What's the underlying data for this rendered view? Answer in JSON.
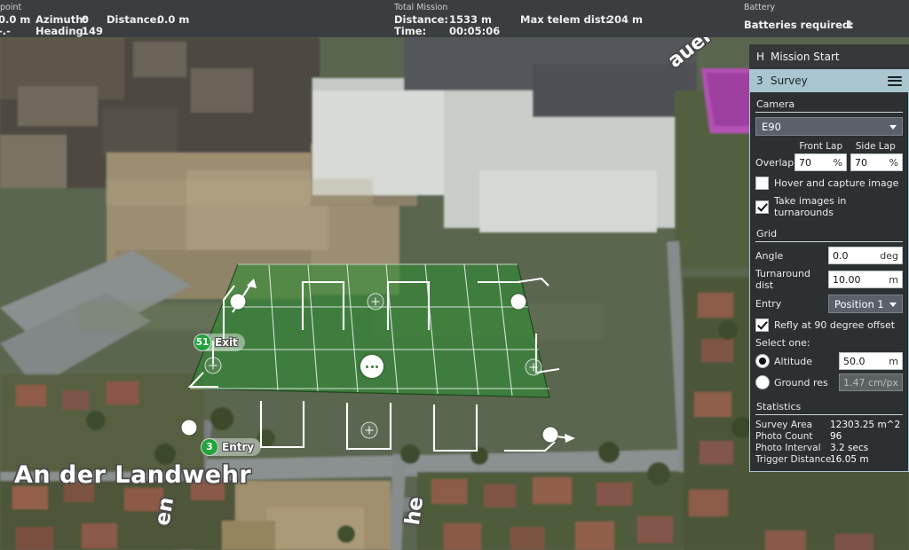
{
  "topbar": {
    "waypoint": {
      "title": "point",
      "rows": [
        {
          "label": "",
          "value": "0.0 m"
        },
        {
          "label": "",
          "value": "-.-"
        }
      ],
      "azimuth_label": "Azimuth:",
      "azimuth_value": "0",
      "heading_label": "Heading:",
      "heading_value": "149",
      "distance_label": "Distance:",
      "distance_value": "0.0 m"
    },
    "total_mission": {
      "title": "Total Mission",
      "distance_label": "Distance:",
      "distance_value": "1533 m",
      "time_label": "Time:",
      "time_value": "00:05:06",
      "max_telem_label": "Max telem dist:",
      "max_telem_value": "204 m"
    },
    "battery": {
      "title": "Battery",
      "required_label": "Batteries required:",
      "required_value": "1"
    }
  },
  "panel": {
    "mission_start": {
      "index": "H",
      "label": "Mission Start"
    },
    "survey": {
      "index": "3",
      "label": "Survey",
      "menu_icon": "hamburger-icon"
    },
    "camera": {
      "section_label": "Camera",
      "selected": "E90",
      "options": [
        "E90"
      ],
      "caret_icon": "chevron-down-icon"
    },
    "overlap": {
      "label": "Overlap",
      "front_lap_header": "Front Lap",
      "side_lap_header": "Side Lap",
      "front_lap_value": "70",
      "front_lap_unit": "%",
      "side_lap_value": "70",
      "side_lap_unit": "%"
    },
    "hover_capture": {
      "label": "Hover and capture image",
      "checked": false
    },
    "turnaround_images": {
      "label": "Take images in turnarounds",
      "checked": true
    },
    "grid": {
      "section_label": "Grid",
      "angle_label": "Angle",
      "angle_value": "0.0",
      "angle_unit": "deg",
      "turnaround_label": "Turnaround dist",
      "turnaround_value": "10.00",
      "turnaround_unit": "m",
      "entry_label": "Entry",
      "entry_value": "Position 1",
      "entry_options": [
        "Position 1"
      ]
    },
    "refly": {
      "label": "Refly at 90 degree offset",
      "checked": true
    },
    "select_one_label": "Select one:",
    "altitude": {
      "label": "Altitude",
      "value": "50.0",
      "unit": "m",
      "selected": true
    },
    "ground_res": {
      "label": "Ground res",
      "value": "1.47",
      "unit": "cm/px",
      "selected": false
    },
    "statistics": {
      "section_label": "Statistics",
      "rows": [
        {
          "key": "Survey Area",
          "value": "12303.25 m^2"
        },
        {
          "key": "Photo Count",
          "value": "96"
        },
        {
          "key": "Photo Interval",
          "value": "3.2 secs"
        },
        {
          "key": "Trigger Distance",
          "value": "16.05 m"
        }
      ]
    }
  },
  "map": {
    "street_labels": [
      {
        "text": "An der Landwehr"
      },
      {
        "text": "auer-All"
      },
      {
        "text": "he"
      },
      {
        "text": "en"
      }
    ],
    "markers": {
      "exit": {
        "num": "51",
        "text": "Exit"
      },
      "entry": {
        "num": "3",
        "text": "Entry"
      }
    },
    "survey_fill_color": "#2f8b34",
    "survey_line_color": "#ffffff",
    "badge_color": "#23a33c"
  }
}
